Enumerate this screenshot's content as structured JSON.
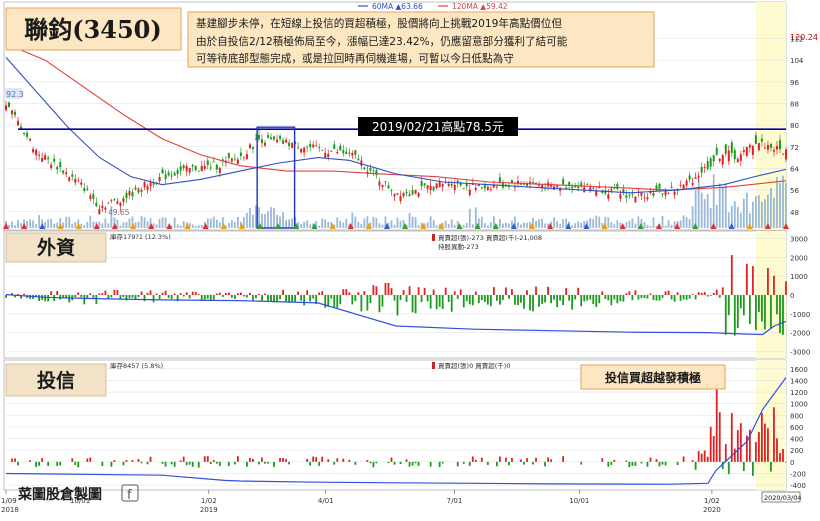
{
  "title": "聯鈞(3450)",
  "summary_lines": [
    "基建腳步未停，在短線上投信的買超積極，股價將向上挑戰2019年高點價位但",
    "由於自投信2/12積極佈局至今，漲幅已達23.42%，仍應留意部分獲利了結可能",
    "可等待底部型態完成，或是拉回時再伺機進場，可暫以今日低點為守"
  ],
  "legend": {
    "ma60_label": "60MA ▲63.66",
    "ma120_label": "120MA ▲59.42"
  },
  "colors": {
    "up": "#e02020",
    "down": "#1a9a1a",
    "ma60": "#3050c0",
    "ma120": "#e04040",
    "volume": "#9ab8d8",
    "highlight": "#fffbd0",
    "high_line": "#0000b0",
    "box_bg": "#fde7c2",
    "box_border": "#e2a35a",
    "panel_bg": "#f2e2c8"
  },
  "high_banner": "2019/02/21高點78.5元",
  "price_panel": {
    "last_price_label": "120.24",
    "low_label": "49.65",
    "left_value_label": "92.3"
  },
  "foreign_panel": {
    "title": "外資",
    "stock_info": "庫存179?1 (12.3%)",
    "legend_line1": "買賣超(張)-273 買賣超(千)-21,008",
    "legend_line2": "持股異動-273"
  },
  "trust_panel": {
    "title": "投信",
    "stock_info": "庫存8457 (5.8%)",
    "legend_line1": "買賣超(張)0 買賣超(千)0",
    "annotation": "投信買超越發積極"
  },
  "watermark": "菜圖股倉製圖",
  "x_axis": {
    "labels": [
      {
        "line1": "1/09",
        "line2": "2018",
        "frac": 0.0
      },
      {
        "line1": "10/01",
        "line2": "",
        "frac": 0.095
      },
      {
        "line1": "1/02",
        "line2": "2019",
        "frac": 0.26
      },
      {
        "line1": "4/01",
        "line2": "",
        "frac": 0.41
      },
      {
        "line1": "7/01",
        "line2": "",
        "frac": 0.575
      },
      {
        "line1": "10/01",
        "line2": "",
        "frac": 0.735
      },
      {
        "line1": "1/02",
        "line2": "2020",
        "frac": 0.905
      }
    ],
    "end_date": "2020/03/04"
  },
  "chart_data": [
    {
      "type": "candlestick",
      "title": "聯鈞(3450)",
      "y_ticks": [
        112,
        104,
        96,
        88,
        80,
        72,
        64,
        56,
        48
      ],
      "ylim": [
        42,
        124
      ],
      "high_reference": 78.5,
      "close_trend": [
        [
          0,
          88
        ],
        [
          0.02,
          79
        ],
        [
          0.04,
          70
        ],
        [
          0.07,
          64
        ],
        [
          0.1,
          57
        ],
        [
          0.12,
          50
        ],
        [
          0.15,
          53
        ],
        [
          0.18,
          58
        ],
        [
          0.21,
          62
        ],
        [
          0.24,
          64
        ],
        [
          0.27,
          65
        ],
        [
          0.3,
          68
        ],
        [
          0.325,
          75
        ],
        [
          0.34,
          74
        ],
        [
          0.37,
          73
        ],
        [
          0.4,
          71
        ],
        [
          0.43,
          70
        ],
        [
          0.45,
          68
        ],
        [
          0.47,
          62
        ],
        [
          0.5,
          55
        ],
        [
          0.53,
          56
        ],
        [
          0.57,
          59
        ],
        [
          0.6,
          57
        ],
        [
          0.64,
          58
        ],
        [
          0.67,
          59
        ],
        [
          0.7,
          57
        ],
        [
          0.73,
          58
        ],
        [
          0.77,
          56
        ],
        [
          0.8,
          54
        ],
        [
          0.83,
          55
        ],
        [
          0.86,
          56
        ],
        [
          0.88,
          60
        ],
        [
          0.9,
          65
        ],
        [
          0.92,
          70
        ],
        [
          0.94,
          68
        ],
        [
          0.96,
          74
        ],
        [
          0.98,
          72
        ],
        [
          1.0,
          70
        ]
      ],
      "ma60_trend": [
        [
          0,
          105
        ],
        [
          0.04,
          92
        ],
        [
          0.08,
          79
        ],
        [
          0.12,
          68
        ],
        [
          0.16,
          61
        ],
        [
          0.2,
          58
        ],
        [
          0.25,
          60
        ],
        [
          0.3,
          63
        ],
        [
          0.35,
          66
        ],
        [
          0.4,
          68
        ],
        [
          0.44,
          67
        ],
        [
          0.5,
          62
        ],
        [
          0.56,
          59
        ],
        [
          0.62,
          58
        ],
        [
          0.68,
          57
        ],
        [
          0.74,
          56
        ],
        [
          0.8,
          55
        ],
        [
          0.86,
          56
        ],
        [
          0.92,
          58
        ],
        [
          0.96,
          61
        ],
        [
          1.0,
          63.66
        ]
      ],
      "ma120_trend": [
        [
          0,
          110
        ],
        [
          0.05,
          104
        ],
        [
          0.1,
          94
        ],
        [
          0.15,
          84
        ],
        [
          0.2,
          75
        ],
        [
          0.25,
          69
        ],
        [
          0.3,
          65
        ],
        [
          0.36,
          63
        ],
        [
          0.42,
          63
        ],
        [
          0.48,
          62
        ],
        [
          0.55,
          61
        ],
        [
          0.62,
          59
        ],
        [
          0.7,
          58
        ],
        [
          0.78,
          57
        ],
        [
          0.85,
          56
        ],
        [
          0.92,
          57
        ],
        [
          0.97,
          58.5
        ],
        [
          1.0,
          59.42
        ]
      ]
    },
    {
      "type": "bar",
      "title": "外資",
      "y_ticks": [
        3000,
        2000,
        1000,
        0,
        -1000,
        -2000,
        -3000
      ],
      "ylim": [
        -3300,
        3300
      ],
      "net_buy_sell_trend": [
        [
          0,
          -200
        ],
        [
          0.1,
          -400
        ],
        [
          0.2,
          -300
        ],
        [
          0.3,
          -200
        ],
        [
          0.4,
          -500
        ],
        [
          0.5,
          -900
        ],
        [
          0.6,
          -600
        ],
        [
          0.7,
          -700
        ],
        [
          0.8,
          -400
        ],
        [
          0.9,
          -200
        ],
        [
          0.94,
          1500
        ],
        [
          0.96,
          -900
        ],
        [
          0.98,
          1800
        ],
        [
          1.0,
          -273
        ]
      ],
      "holding_change_trend": [
        [
          0,
          20
        ],
        [
          0.05,
          -120
        ],
        [
          0.1,
          -180
        ],
        [
          0.2,
          -260
        ],
        [
          0.3,
          -300
        ],
        [
          0.4,
          -420
        ],
        [
          0.5,
          -1650
        ],
        [
          0.6,
          -1820
        ],
        [
          0.7,
          -1900
        ],
        [
          0.8,
          -1980
        ],
        [
          0.9,
          -2000
        ],
        [
          0.95,
          -2080
        ],
        [
          0.97,
          -2100
        ],
        [
          0.985,
          -1650
        ],
        [
          1.0,
          -1400
        ]
      ]
    },
    {
      "type": "bar",
      "title": "投信",
      "y_ticks": [
        1600,
        1400,
        1200,
        1000,
        800,
        600,
        400,
        200,
        0,
        -200,
        -400
      ],
      "ylim": [
        -450,
        1700
      ],
      "net_buy_sell_trend": [
        [
          0,
          -40
        ],
        [
          0.2,
          -60
        ],
        [
          0.3,
          -50
        ],
        [
          0.5,
          0
        ],
        [
          0.88,
          80
        ],
        [
          0.9,
          300
        ],
        [
          0.91,
          1350
        ],
        [
          0.92,
          1100
        ],
        [
          0.95,
          700
        ],
        [
          0.97,
          1100
        ],
        [
          0.99,
          800
        ],
        [
          1.0,
          0
        ]
      ],
      "holding_change_trend": [
        [
          0,
          -200
        ],
        [
          0.2,
          -230
        ],
        [
          0.28,
          -320
        ],
        [
          0.3,
          -330
        ],
        [
          0.4,
          -350
        ],
        [
          0.5,
          -360
        ],
        [
          0.6,
          -370
        ],
        [
          0.7,
          -380
        ],
        [
          0.85,
          -385
        ],
        [
          0.9,
          -370
        ],
        [
          0.91,
          -150
        ],
        [
          0.93,
          100
        ],
        [
          0.95,
          350
        ],
        [
          0.97,
          900
        ],
        [
          1.0,
          1450
        ]
      ]
    }
  ]
}
